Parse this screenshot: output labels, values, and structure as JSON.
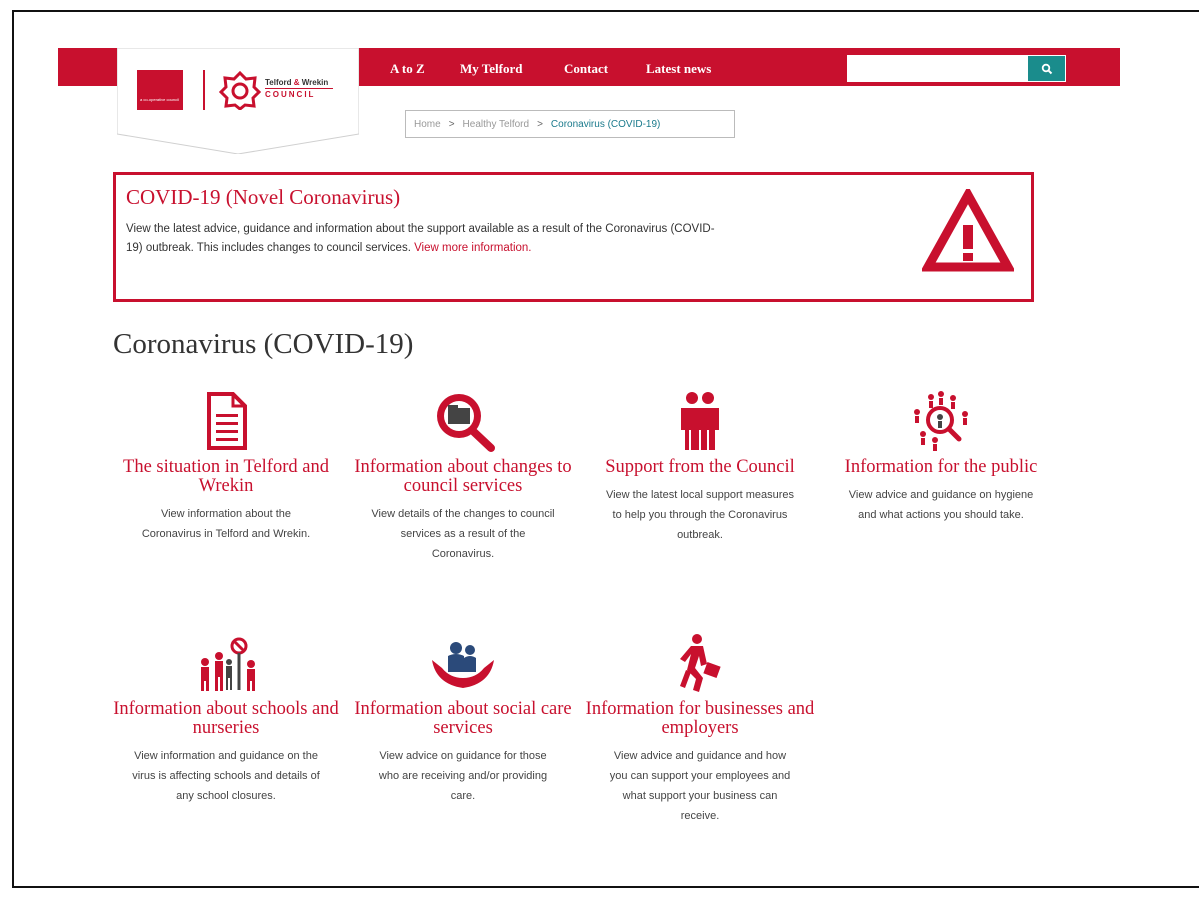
{
  "logo": {
    "tagline": "a co-operative council",
    "name_line1": "Telford",
    "name_amp": " & ",
    "name_line1b": "Wrekin",
    "name_line2": "COUNCIL"
  },
  "nav": {
    "items": [
      {
        "label": "A to Z"
      },
      {
        "label": "My Telford"
      },
      {
        "label": "Contact"
      },
      {
        "label": "Latest news"
      }
    ]
  },
  "search": {
    "placeholder": "",
    "button_icon": "search-icon"
  },
  "breadcrumb": {
    "home": "Home",
    "sep1": ">",
    "level2": "Healthy Telford",
    "sep2": ">",
    "current": "Coronavirus (COVID-19)"
  },
  "alert": {
    "title": "COVID-19 (Novel Coronavirus)",
    "body": "View the latest advice, guidance and information about the support available as a result of the Coronavirus (COVID-19) outbreak. This includes changes to council services. ",
    "link": "View more information",
    "link_suffix": ".",
    "icon": "warning-icon"
  },
  "page": {
    "title": "Coronavirus (COVID-19)"
  },
  "tiles": [
    {
      "icon": "document-icon",
      "title": "The situation in Telford and Wrekin",
      "desc": "View information about the Coronavirus in Telford and Wrekin."
    },
    {
      "icon": "search-folder-icon",
      "title": "Information about changes to council services",
      "desc": "View details of the changes to council services as a result of the Coronavirus."
    },
    {
      "icon": "people-support-icon",
      "title": "Support from the Council",
      "desc": "View the latest local support measures to help you through the Coronavirus outbreak."
    },
    {
      "icon": "public-search-icon",
      "title": "Information for the public",
      "desc": "View advice and guidance on hygiene and what actions you should take."
    },
    {
      "icon": "school-children-icon",
      "title": "Information about schools and nurseries",
      "desc": "View information and guidance on the virus is affecting schools and details of any school closures."
    },
    {
      "icon": "care-hands-icon",
      "title": "Information about social care services",
      "desc": "View advice on guidance for those who are receiving and/or providing care."
    },
    {
      "icon": "business-person-icon",
      "title": "Information for businesses and employers",
      "desc": "View advice and guidance and how you can support your employees and what support your business can receive."
    }
  ],
  "colors": {
    "brand": "#c8102e",
    "search_button": "#1a8c8c",
    "breadcrumb_current": "#1a7a8c"
  }
}
